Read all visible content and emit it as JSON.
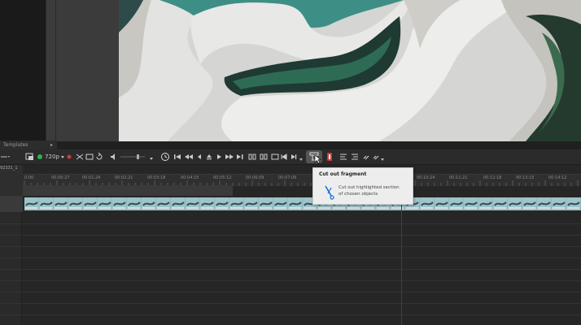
{
  "panel": {
    "tab_label": "Templates",
    "tab_arrow": "▸"
  },
  "toolbar": {
    "resolution": "720p"
  },
  "project": {
    "name": "92331_1"
  },
  "ruler": {
    "ticks": [
      "0:00",
      "00:00:27",
      "00:01:24",
      "00:02:21",
      "00:03:18",
      "00:04:15",
      "00:05:12",
      "00:06:09",
      "00:07:06",
      "00:10:24",
      "00:11:21",
      "00:12:18",
      "00:13:15",
      "00:14:12"
    ]
  },
  "tooltip": {
    "title": "Cut out fragment",
    "desc_line1": "Cut out highlighted section",
    "desc_line2": "of chosen objects"
  },
  "colors": {
    "clip": "#8fb6bd",
    "playhead": "#7a2a22",
    "accent_red": "#d23a3a",
    "record_green": "#2fb24a"
  },
  "icons": [
    "settings-icon",
    "record-icon",
    "split-icon",
    "undo-icon",
    "redo-icon",
    "volume-icon",
    "clock-icon",
    "skip-start-icon",
    "prev-frame-icon",
    "play-icon",
    "next-frame-icon",
    "skip-end-icon",
    "cut-fragment-icon",
    "marker-icon",
    "align-icon",
    "link-icon",
    "scissors-icon"
  ]
}
